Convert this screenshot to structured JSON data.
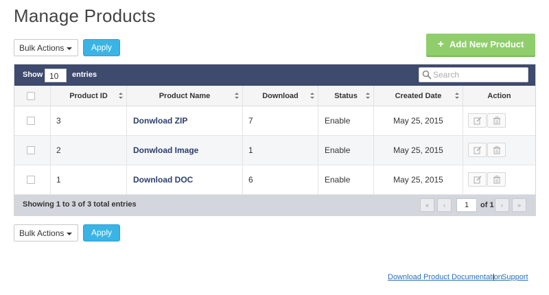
{
  "page": {
    "title": "Manage Products"
  },
  "bulk_top": {
    "select_label": "Bulk Actions",
    "apply_label": "Apply"
  },
  "bulk_bottom": {
    "select_label": "Bulk Actions",
    "apply_label": "Apply"
  },
  "add_button": {
    "label": "Add New Product",
    "icon": "plus-icon"
  },
  "toolbar": {
    "show_label": "Show",
    "entries_value": "10",
    "entries_label": "entries",
    "search_placeholder": "Search"
  },
  "table": {
    "columns": [
      "Product ID",
      "Product Name",
      "Download",
      "Status",
      "Created Date",
      "Action"
    ],
    "rows": [
      {
        "id": "3",
        "name": "Donwload ZIP",
        "download": "7",
        "status": "Enable",
        "created": "May 25, 2015"
      },
      {
        "id": "2",
        "name": "Donwload Image",
        "download": "1",
        "status": "Enable",
        "created": "May 25, 2015"
      },
      {
        "id": "1",
        "name": "Download DOC",
        "download": "6",
        "status": "Enable",
        "created": "May 25, 2015"
      }
    ]
  },
  "pagination": {
    "info": "Showing 1 to 3 of 3 total entries",
    "current_page": "1",
    "of_label": "of 1",
    "first_icon": "«",
    "prev_icon": "‹",
    "next_icon": "›",
    "last_icon": "»"
  },
  "footer_links": {
    "docs": "Download Product Documentation",
    "separator": "|",
    "support": "Support"
  },
  "colors": {
    "toolbar_bg": "#3e4a6e",
    "apply_bg": "#3ab4e4",
    "add_bg": "#8fce6b",
    "name_link": "#2c3e6b",
    "footer_bg": "#d3d6dc"
  }
}
